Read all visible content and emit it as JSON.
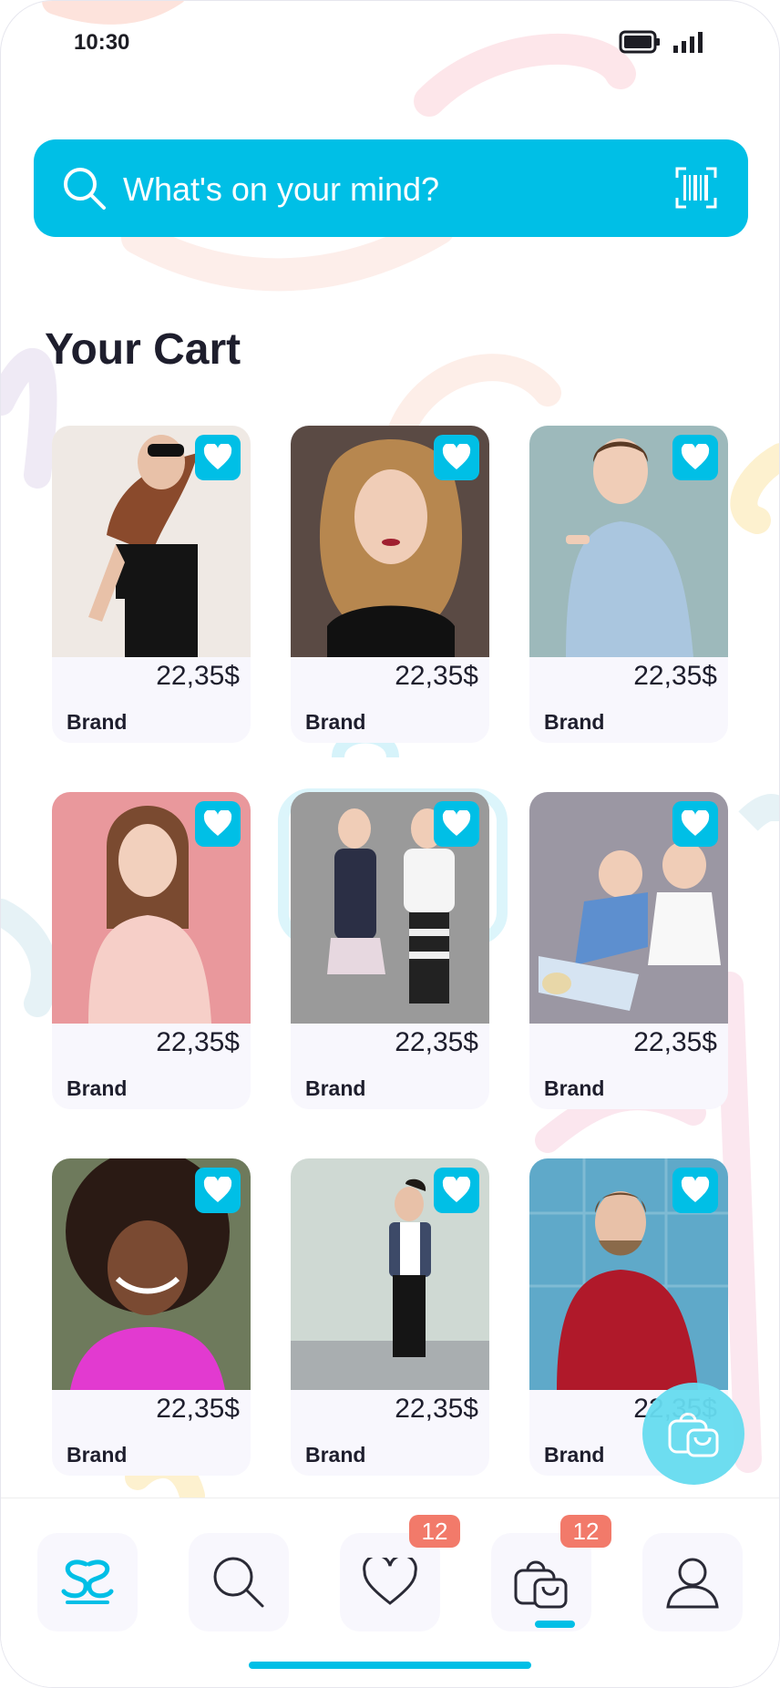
{
  "status": {
    "time": "10:30"
  },
  "search": {
    "placeholder": "What's on your mind?"
  },
  "page_title": "Your Cart",
  "products": [
    {
      "price": "22,35$",
      "brand": "Brand",
      "img": "woman-sunglasses"
    },
    {
      "price": "22,35$",
      "brand": "Brand",
      "img": "woman-curly-hair"
    },
    {
      "price": "22,35$",
      "brand": "Brand",
      "img": "woman-blue-blazer"
    },
    {
      "price": "22,35$",
      "brand": "Brand",
      "img": "woman-pink-blouse"
    },
    {
      "price": "22,35$",
      "brand": "Brand",
      "img": "kids-standing"
    },
    {
      "price": "22,35$",
      "brand": "Brand",
      "img": "kids-sitting"
    },
    {
      "price": "22,35$",
      "brand": "Brand",
      "img": "girl-curly-hair"
    },
    {
      "price": "22,35$",
      "brand": "Brand",
      "img": "boy-leaning"
    },
    {
      "price": "22,35$",
      "brand": "Brand",
      "img": "man-red-sweater"
    }
  ],
  "nav": {
    "favorites_badge": "12",
    "cart_badge": "12",
    "items": [
      "home-icon",
      "search-icon",
      "heart-icon",
      "bag-icon",
      "user-icon"
    ],
    "active": "bag-icon"
  },
  "colors": {
    "accent": "#00bfe6",
    "badge": "#f27a6a",
    "text": "#1e1e2d"
  }
}
